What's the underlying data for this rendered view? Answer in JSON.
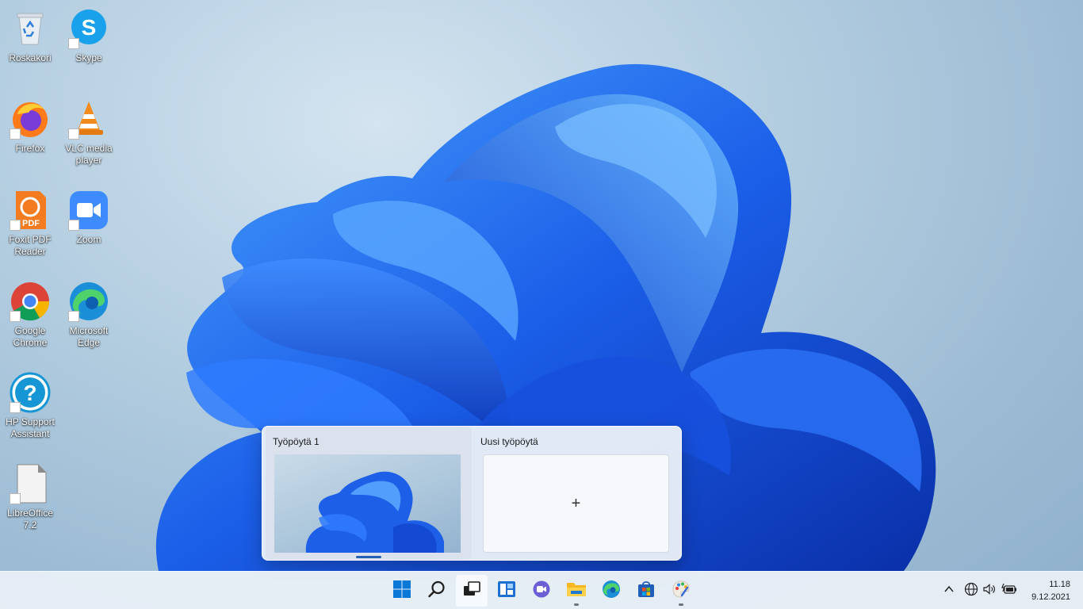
{
  "desktop": {
    "icons": [
      {
        "label": "Roskakori",
        "icon": "recycle-bin-icon"
      },
      {
        "label": "Skype",
        "icon": "skype-icon"
      },
      {
        "label": "Firefox",
        "icon": "firefox-icon"
      },
      {
        "label": "VLC media player",
        "icon": "vlc-icon"
      },
      {
        "label": "Foxit PDF Reader",
        "icon": "foxit-pdf-icon",
        "badge": "PDF"
      },
      {
        "label": "Zoom",
        "icon": "zoom-icon"
      },
      {
        "label": "Google Chrome",
        "icon": "chrome-icon"
      },
      {
        "label": "Microsoft Edge",
        "icon": "edge-icon"
      },
      {
        "label": "HP Support Assistant",
        "icon": "hp-support-icon",
        "glyph": "?"
      },
      {
        "label": "LibreOffice 7.2",
        "icon": "libreoffice-icon"
      }
    ]
  },
  "virtual_desktops": {
    "desktops": [
      {
        "title": "Työpöytä 1"
      }
    ],
    "new_desktop": {
      "title": "Uusi työpöytä",
      "plus": "+"
    }
  },
  "taskbar": {
    "apps": [
      {
        "name": "Start",
        "icon": "windows-start-icon"
      },
      {
        "name": "Search",
        "icon": "search-icon"
      },
      {
        "name": "Task View",
        "icon": "task-view-icon"
      },
      {
        "name": "Widgets",
        "icon": "widgets-icon"
      },
      {
        "name": "Chat",
        "icon": "teams-chat-icon"
      },
      {
        "name": "File Explorer",
        "icon": "file-explorer-icon"
      },
      {
        "name": "Microsoft Edge",
        "icon": "edge-icon"
      },
      {
        "name": "Microsoft Store",
        "icon": "store-icon"
      },
      {
        "name": "Paint",
        "icon": "paint-icon"
      }
    ],
    "tray": [
      "chevron-up-icon",
      "network-icon",
      "volume-icon",
      "battery-icon"
    ],
    "clock": {
      "time": "11.18",
      "date": "9.12.2021"
    }
  },
  "colors": {
    "accent": "#0067c0",
    "bloom_blue": "#1a5fe0",
    "taskbar": "#e8eef6"
  }
}
